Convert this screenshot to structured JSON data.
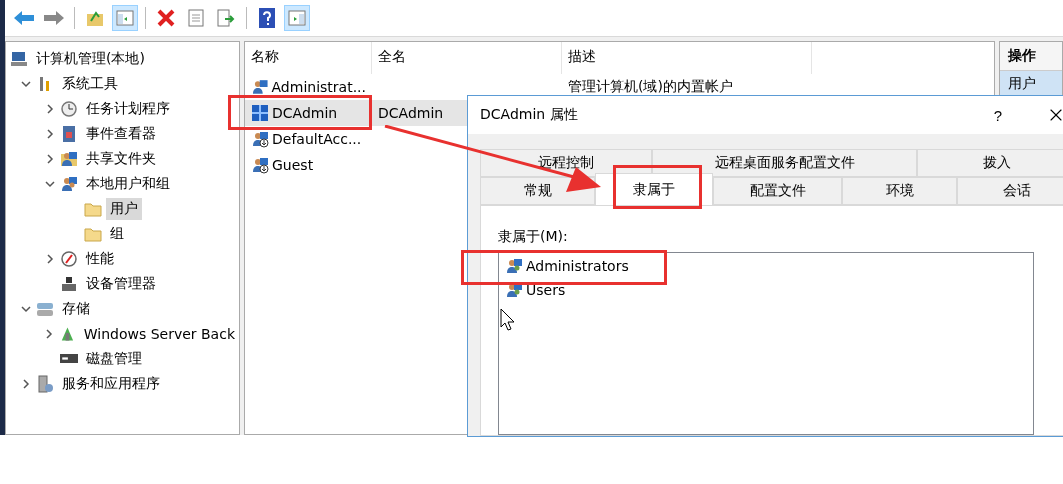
{
  "toolbar": [
    {
      "kind": "back",
      "on": false
    },
    {
      "kind": "forward",
      "on": false
    },
    {
      "kind": "up",
      "on": false
    },
    {
      "kind": "tree",
      "on": true
    },
    {
      "kind": "delete",
      "on": false
    },
    {
      "kind": "properties",
      "on": false
    },
    {
      "kind": "export",
      "on": false
    },
    {
      "kind": "help",
      "on": false
    },
    {
      "kind": "actions",
      "on": true
    }
  ],
  "tree": [
    {
      "label": "计算机管理(本地)",
      "kind": "computer",
      "selected": false,
      "children": [
        {
          "label": "系统工具",
          "kind": "tools",
          "expanded": true,
          "selected": false,
          "children": [
            {
              "label": "任务计划程序",
              "kind": "clock",
              "expanded": false,
              "selected": false
            },
            {
              "label": "事件查看器",
              "kind": "log",
              "expanded": false,
              "selected": false
            },
            {
              "label": "共享文件夹",
              "kind": "share",
              "expanded": false,
              "selected": false
            },
            {
              "label": "本地用户和组",
              "kind": "users",
              "expanded": true,
              "selected": false,
              "children": [
                {
                  "label": "用户",
                  "kind": "folder",
                  "selected": true
                },
                {
                  "label": "组",
                  "kind": "folder",
                  "selected": false
                }
              ]
            },
            {
              "label": "性能",
              "kind": "gauge",
              "expanded": false,
              "selected": false
            },
            {
              "label": "设备管理器",
              "kind": "device",
              "selected": false
            }
          ]
        },
        {
          "label": "存储",
          "kind": "storage",
          "expanded": true,
          "selected": false,
          "children": [
            {
              "label": "Windows Server Back",
              "kind": "backup",
              "expanded": false,
              "selected": false
            },
            {
              "label": "磁盘管理",
              "kind": "disk",
              "selected": false
            }
          ]
        },
        {
          "label": "服务和应用程序",
          "kind": "server",
          "expanded": false,
          "selected": false
        }
      ]
    }
  ],
  "list": {
    "columns": [
      "名称",
      "全名",
      "描述"
    ],
    "rows": [
      {
        "name": "Administrat...",
        "kind": "admin",
        "full_name": "",
        "description": "管理计算机(域)的内置帐户",
        "selected": false
      },
      {
        "name": "DCAdmin",
        "kind": "dcadmin",
        "full_name": "DCAdmin",
        "description": "",
        "selected": true
      },
      {
        "name": "DefaultAcc...",
        "kind": "disabled",
        "full_name": "",
        "description": "",
        "selected": false
      },
      {
        "name": "Guest",
        "kind": "disabled",
        "full_name": "",
        "description": "",
        "selected": false
      }
    ]
  },
  "actions": {
    "title": "操作",
    "items": [
      "用户"
    ]
  },
  "dialog": {
    "title": "DCAdmin 属性",
    "help": "?",
    "tab_rows": [
      [
        {
          "label": "远程控制",
          "selected": false
        },
        {
          "label": "远程桌面服务配置文件",
          "selected": false
        },
        {
          "label": "拨入",
          "selected": false
        }
      ],
      [
        {
          "label": "常规",
          "selected": false
        },
        {
          "label": "隶属于",
          "selected": true
        },
        {
          "label": "配置文件",
          "selected": false
        },
        {
          "label": "环境",
          "selected": false
        },
        {
          "label": "会话",
          "selected": false
        }
      ]
    ],
    "member_label": "隶属于(M):",
    "members": [
      "Administrators",
      "Users"
    ]
  }
}
